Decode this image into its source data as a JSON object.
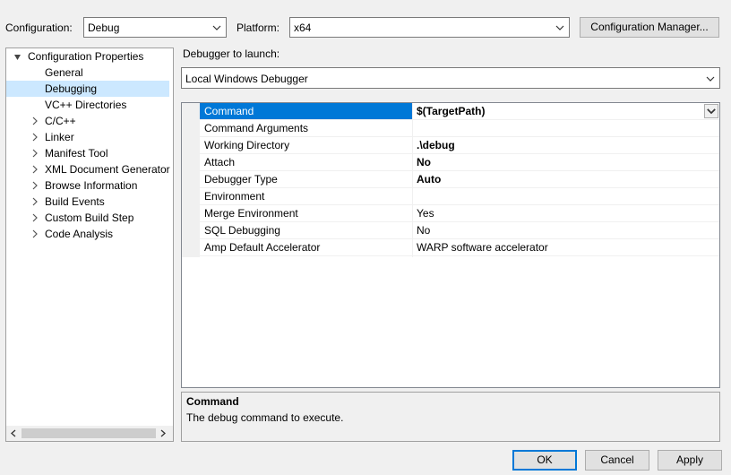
{
  "top": {
    "configuration_label": "Configuration:",
    "configuration_value": "Debug",
    "platform_label": "Platform:",
    "platform_value": "x64",
    "config_manager_label": "Configuration Manager..."
  },
  "tree": {
    "root": "Configuration Properties",
    "items": [
      {
        "label": "General",
        "expandable": false,
        "selected": false
      },
      {
        "label": "Debugging",
        "expandable": false,
        "selected": true
      },
      {
        "label": "VC++ Directories",
        "expandable": false,
        "selected": false
      },
      {
        "label": "C/C++",
        "expandable": true,
        "selected": false
      },
      {
        "label": "Linker",
        "expandable": true,
        "selected": false
      },
      {
        "label": "Manifest Tool",
        "expandable": true,
        "selected": false
      },
      {
        "label": "XML Document Generator",
        "expandable": true,
        "selected": false
      },
      {
        "label": "Browse Information",
        "expandable": true,
        "selected": false
      },
      {
        "label": "Build Events",
        "expandable": true,
        "selected": false
      },
      {
        "label": "Custom Build Step",
        "expandable": true,
        "selected": false
      },
      {
        "label": "Code Analysis",
        "expandable": true,
        "selected": false
      }
    ]
  },
  "debugger": {
    "launch_label": "Debugger to launch:",
    "launch_value": "Local Windows Debugger"
  },
  "properties": [
    {
      "name": "Command",
      "value": "$(TargetPath)",
      "bold": true
    },
    {
      "name": "Command Arguments",
      "value": "",
      "bold": false
    },
    {
      "name": "Working Directory",
      "value": ".\\debug",
      "bold": true
    },
    {
      "name": "Attach",
      "value": "No",
      "bold": true
    },
    {
      "name": "Debugger Type",
      "value": "Auto",
      "bold": true
    },
    {
      "name": "Environment",
      "value": "",
      "bold": false
    },
    {
      "name": "Merge Environment",
      "value": "Yes",
      "bold": false
    },
    {
      "name": "SQL Debugging",
      "value": "No",
      "bold": false
    },
    {
      "name": "Amp Default Accelerator",
      "value": "WARP software accelerator",
      "bold": false
    }
  ],
  "description": {
    "title": "Command",
    "text": "The debug command to execute."
  },
  "buttons": {
    "ok": "OK",
    "cancel": "Cancel",
    "apply": "Apply"
  },
  "colors": {
    "selection_accent": "#0078d7",
    "tree_selection": "#cce8ff"
  }
}
